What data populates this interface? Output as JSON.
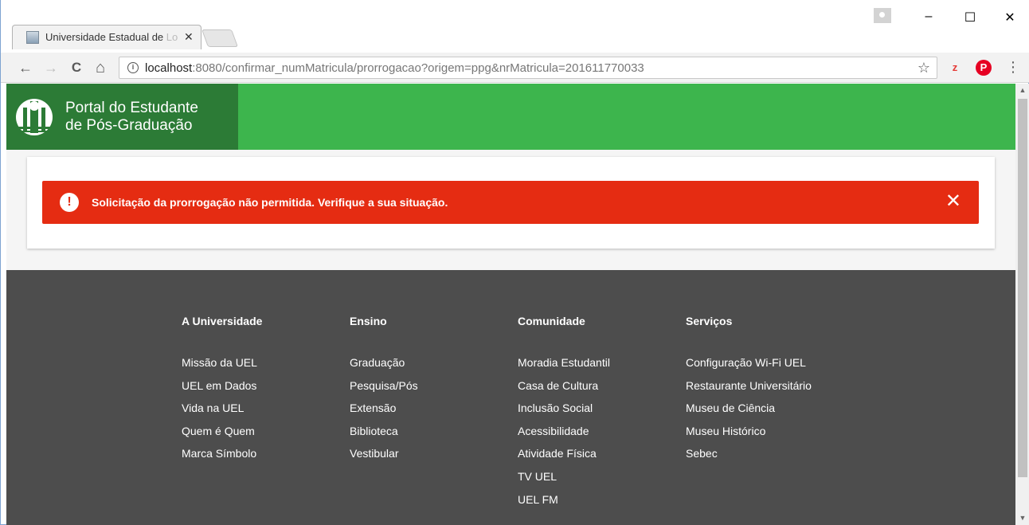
{
  "browser": {
    "tab_title": "Universidade Estadual de",
    "tab_title_fade": " Lo",
    "url_host": "localhost",
    "url_rest": ":8080/confirmar_numMatricula/prorrogacao?origem=ppg&nrMatricula=201611770033",
    "minimize": "–",
    "maximize": "☐",
    "close": "✕",
    "back": "←",
    "forward": "→",
    "reload": "C",
    "home": "⌂",
    "info": "i",
    "star": "☆",
    "ext_z": "z",
    "ext_p": "P",
    "menu": "⋮",
    "tab_close": "✕"
  },
  "header": {
    "brand_line1": "Portal do Estudante",
    "brand_line2": "de Pós-Graduação"
  },
  "alert": {
    "icon": "!",
    "message": "Solicitação da prorrogação não permitida. Verifique a sua situação.",
    "close": "✕",
    "color": "#e52c12"
  },
  "footer": {
    "columns": [
      {
        "title": "A Universidade",
        "links": [
          "Missão da UEL",
          "UEL em Dados",
          "Vida na UEL",
          "Quem é Quem",
          "Marca Símbolo"
        ]
      },
      {
        "title": "Ensino",
        "links": [
          "Graduação",
          "Pesquisa/Pós",
          "Extensão",
          "Biblioteca",
          "Vestibular"
        ]
      },
      {
        "title": "Comunidade",
        "links": [
          "Moradia Estudantil",
          "Casa de Cultura",
          "Inclusão Social",
          "Acessibilidade",
          "Atividade Física",
          "TV UEL",
          "UEL FM"
        ]
      },
      {
        "title": "Serviços",
        "links": [
          "Configuração Wi-Fi UEL",
          "Restaurante Universitário",
          "Museu de Ciência",
          "Museu Histórico",
          "Sebec"
        ]
      }
    ]
  },
  "colors": {
    "header_green": "#3db54d",
    "brand_green": "#2c7b36",
    "footer_gray": "#4d4d4d"
  }
}
